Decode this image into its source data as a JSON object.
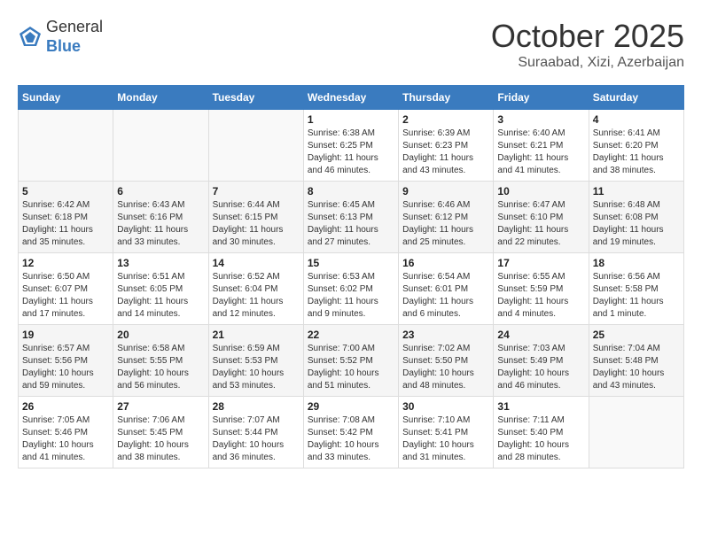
{
  "header": {
    "logo": {
      "general": "General",
      "blue": "Blue"
    },
    "title": "October 2025",
    "location": "Suraabad, Xizi, Azerbaijan"
  },
  "calendar": {
    "headers": [
      "Sunday",
      "Monday",
      "Tuesday",
      "Wednesday",
      "Thursday",
      "Friday",
      "Saturday"
    ],
    "weeks": [
      [
        {
          "day": "",
          "info": ""
        },
        {
          "day": "",
          "info": ""
        },
        {
          "day": "",
          "info": ""
        },
        {
          "day": "1",
          "info": "Sunrise: 6:38 AM\nSunset: 6:25 PM\nDaylight: 11 hours\nand 46 minutes."
        },
        {
          "day": "2",
          "info": "Sunrise: 6:39 AM\nSunset: 6:23 PM\nDaylight: 11 hours\nand 43 minutes."
        },
        {
          "day": "3",
          "info": "Sunrise: 6:40 AM\nSunset: 6:21 PM\nDaylight: 11 hours\nand 41 minutes."
        },
        {
          "day": "4",
          "info": "Sunrise: 6:41 AM\nSunset: 6:20 PM\nDaylight: 11 hours\nand 38 minutes."
        }
      ],
      [
        {
          "day": "5",
          "info": "Sunrise: 6:42 AM\nSunset: 6:18 PM\nDaylight: 11 hours\nand 35 minutes."
        },
        {
          "day": "6",
          "info": "Sunrise: 6:43 AM\nSunset: 6:16 PM\nDaylight: 11 hours\nand 33 minutes."
        },
        {
          "day": "7",
          "info": "Sunrise: 6:44 AM\nSunset: 6:15 PM\nDaylight: 11 hours\nand 30 minutes."
        },
        {
          "day": "8",
          "info": "Sunrise: 6:45 AM\nSunset: 6:13 PM\nDaylight: 11 hours\nand 27 minutes."
        },
        {
          "day": "9",
          "info": "Sunrise: 6:46 AM\nSunset: 6:12 PM\nDaylight: 11 hours\nand 25 minutes."
        },
        {
          "day": "10",
          "info": "Sunrise: 6:47 AM\nSunset: 6:10 PM\nDaylight: 11 hours\nand 22 minutes."
        },
        {
          "day": "11",
          "info": "Sunrise: 6:48 AM\nSunset: 6:08 PM\nDaylight: 11 hours\nand 19 minutes."
        }
      ],
      [
        {
          "day": "12",
          "info": "Sunrise: 6:50 AM\nSunset: 6:07 PM\nDaylight: 11 hours\nand 17 minutes."
        },
        {
          "day": "13",
          "info": "Sunrise: 6:51 AM\nSunset: 6:05 PM\nDaylight: 11 hours\nand 14 minutes."
        },
        {
          "day": "14",
          "info": "Sunrise: 6:52 AM\nSunset: 6:04 PM\nDaylight: 11 hours\nand 12 minutes."
        },
        {
          "day": "15",
          "info": "Sunrise: 6:53 AM\nSunset: 6:02 PM\nDaylight: 11 hours\nand 9 minutes."
        },
        {
          "day": "16",
          "info": "Sunrise: 6:54 AM\nSunset: 6:01 PM\nDaylight: 11 hours\nand 6 minutes."
        },
        {
          "day": "17",
          "info": "Sunrise: 6:55 AM\nSunset: 5:59 PM\nDaylight: 11 hours\nand 4 minutes."
        },
        {
          "day": "18",
          "info": "Sunrise: 6:56 AM\nSunset: 5:58 PM\nDaylight: 11 hours\nand 1 minute."
        }
      ],
      [
        {
          "day": "19",
          "info": "Sunrise: 6:57 AM\nSunset: 5:56 PM\nDaylight: 10 hours\nand 59 minutes."
        },
        {
          "day": "20",
          "info": "Sunrise: 6:58 AM\nSunset: 5:55 PM\nDaylight: 10 hours\nand 56 minutes."
        },
        {
          "day": "21",
          "info": "Sunrise: 6:59 AM\nSunset: 5:53 PM\nDaylight: 10 hours\nand 53 minutes."
        },
        {
          "day": "22",
          "info": "Sunrise: 7:00 AM\nSunset: 5:52 PM\nDaylight: 10 hours\nand 51 minutes."
        },
        {
          "day": "23",
          "info": "Sunrise: 7:02 AM\nSunset: 5:50 PM\nDaylight: 10 hours\nand 48 minutes."
        },
        {
          "day": "24",
          "info": "Sunrise: 7:03 AM\nSunset: 5:49 PM\nDaylight: 10 hours\nand 46 minutes."
        },
        {
          "day": "25",
          "info": "Sunrise: 7:04 AM\nSunset: 5:48 PM\nDaylight: 10 hours\nand 43 minutes."
        }
      ],
      [
        {
          "day": "26",
          "info": "Sunrise: 7:05 AM\nSunset: 5:46 PM\nDaylight: 10 hours\nand 41 minutes."
        },
        {
          "day": "27",
          "info": "Sunrise: 7:06 AM\nSunset: 5:45 PM\nDaylight: 10 hours\nand 38 minutes."
        },
        {
          "day": "28",
          "info": "Sunrise: 7:07 AM\nSunset: 5:44 PM\nDaylight: 10 hours\nand 36 minutes."
        },
        {
          "day": "29",
          "info": "Sunrise: 7:08 AM\nSunset: 5:42 PM\nDaylight: 10 hours\nand 33 minutes."
        },
        {
          "day": "30",
          "info": "Sunrise: 7:10 AM\nSunset: 5:41 PM\nDaylight: 10 hours\nand 31 minutes."
        },
        {
          "day": "31",
          "info": "Sunrise: 7:11 AM\nSunset: 5:40 PM\nDaylight: 10 hours\nand 28 minutes."
        },
        {
          "day": "",
          "info": ""
        }
      ]
    ]
  }
}
